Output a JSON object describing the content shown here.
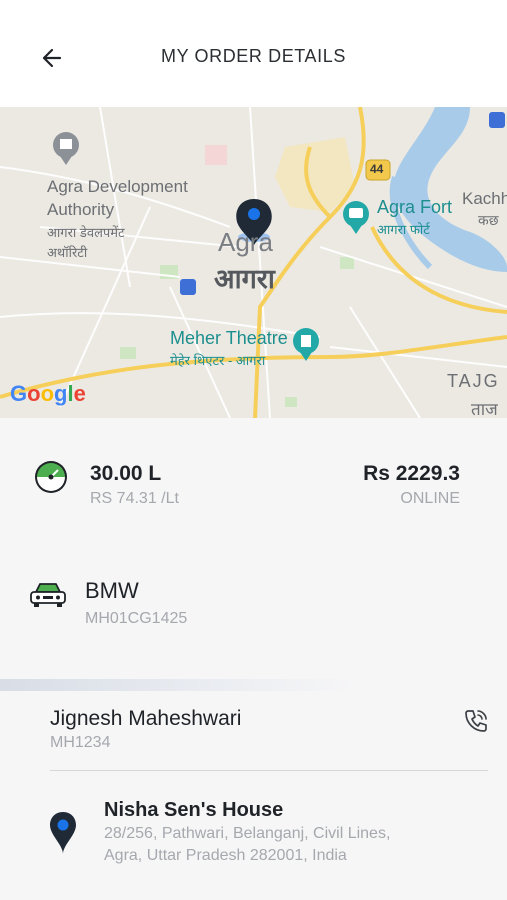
{
  "header": {
    "title": "MY ORDER DETAILS"
  },
  "map": {
    "labels": {
      "adaEn1": "Agra Development",
      "adaEn2": "Authority",
      "adaHi1": "आगरा डेवलपमेंट",
      "adaHi2": "अथॉरिटी",
      "agraEn": "Agra",
      "agraHi": "आगरा",
      "fortEn": "Agra Fort",
      "fortHi": "आगरा फोर्ट",
      "kachEn": "Kachh",
      "kachHi": "कछ",
      "meherEn": "Meher Theatre",
      "meherHi": "मेहेर थिएटर - आगरा",
      "tajEn": "TAJG",
      "tajHi": "ताज",
      "highway": "44",
      "google": "Google"
    }
  },
  "order": {
    "quantity": "30.00 L",
    "rate": "RS 74.31 /Lt",
    "amount": "Rs 2229.3",
    "payment": "ONLINE"
  },
  "vehicle": {
    "name": "BMW",
    "plate": "MH01CG1425"
  },
  "driver": {
    "name": "Jignesh Maheshwari",
    "id": "MH1234"
  },
  "address": {
    "title": "Nisha Sen's House",
    "line1": "28/256, Pathwari, Belanganj, Civil Lines,",
    "line2": "Agra, Uttar Pradesh 282001, India"
  },
  "colors": {
    "accent": "#1a73e8",
    "pin": "#1f2a36",
    "gauge": "#4cae4f",
    "river": "#a8cbe9"
  }
}
